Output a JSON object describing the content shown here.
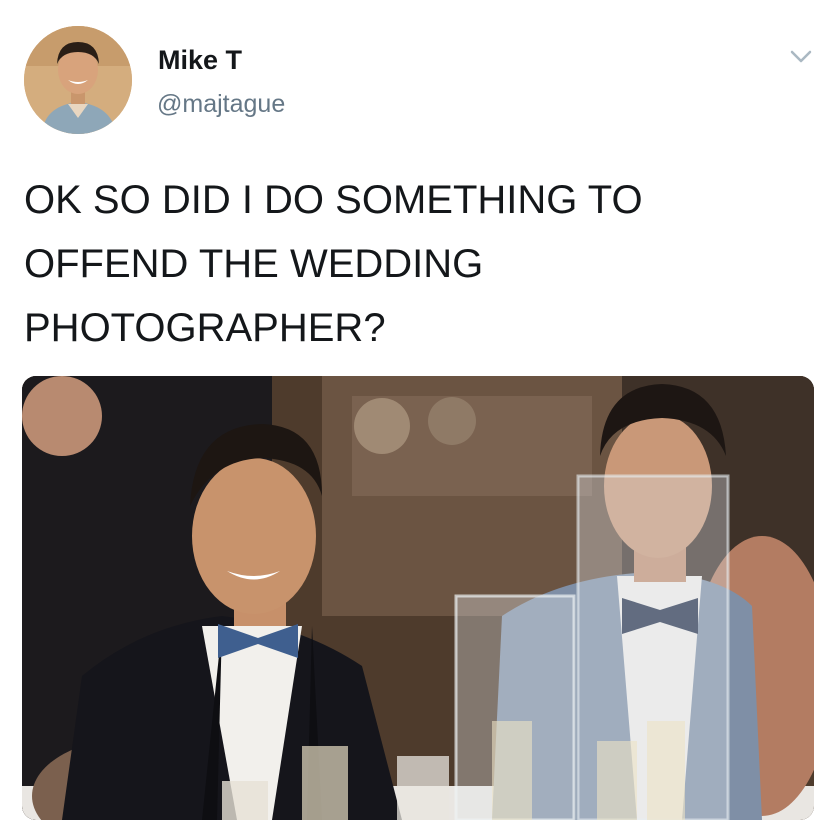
{
  "tweet": {
    "author_name": "Mike T",
    "author_handle": "@majtague",
    "text": "OK SO DID I DO SOMETHING TO OFFEND THE WEDDING PHOTOGRAPHER?"
  },
  "icons": {
    "menu": "chevron-down-icon"
  },
  "colors": {
    "text": "#14171a",
    "secondary_text": "#657786"
  }
}
